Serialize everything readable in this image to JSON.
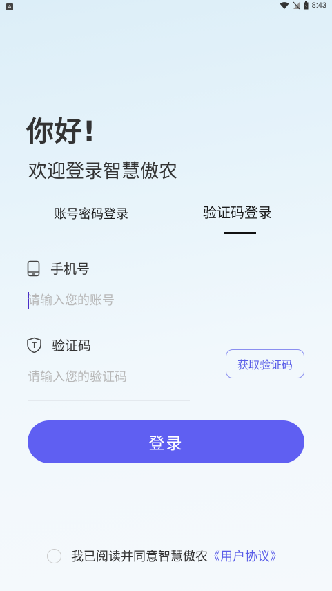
{
  "status_bar": {
    "time": "8:43",
    "left_badge": "A"
  },
  "greeting": "你好!",
  "welcome": "欢迎登录智慧傲农",
  "tabs": {
    "password_login": "账号密码登录",
    "code_login": "验证码登录",
    "active": "code_login"
  },
  "phone_field": {
    "label": "手机号",
    "placeholder": "请输入您的账号",
    "value": ""
  },
  "code_field": {
    "label": "验证码",
    "placeholder": "请输入您的验证码",
    "value": ""
  },
  "get_code_button": "获取验证码",
  "login_button": "登录",
  "agreement": {
    "text": "我已阅读并同意智慧傲农",
    "link": "《用户协议》",
    "checked": false
  },
  "colors": {
    "accent": "#5f5ff2",
    "link": "#5a5ee8",
    "text": "#333333"
  }
}
